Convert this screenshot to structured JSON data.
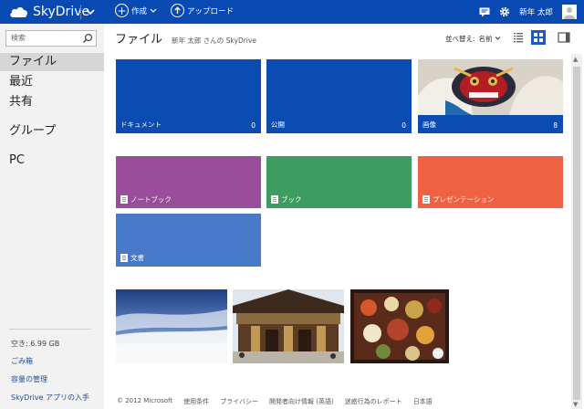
{
  "header": {
    "brand": "SkyDrive",
    "create_label": "作成",
    "upload_label": "アップロード",
    "user_name": "新年 太郎"
  },
  "sidebar": {
    "search_placeholder": "検索",
    "items": [
      {
        "label": "ファイル",
        "active": true
      },
      {
        "label": "最近"
      },
      {
        "label": "共有"
      },
      {
        "label": "グループ"
      },
      {
        "label": "PC"
      }
    ],
    "storage": "空き: 6.99 GB",
    "links": [
      "ごみ箱",
      "容量の管理",
      "SkyDrive アプリの入手"
    ]
  },
  "main": {
    "title": "ファイル",
    "owner": "新年 太郎 さんの SkyDrive",
    "sort_label": "並べ替え:",
    "sort_value": "名前",
    "folders": [
      {
        "label": "ドキュメント",
        "count": "0",
        "color": "#0a4cb2"
      },
      {
        "label": "公開",
        "count": "0",
        "color": "#0a4cb2"
      },
      {
        "label": "画像",
        "count": "8",
        "color": "#0a4cb2"
      }
    ],
    "docs": [
      {
        "label": "ノートブック",
        "color": "#9a4d9a"
      },
      {
        "label": "ブック",
        "color": "#3d9c5f"
      },
      {
        "label": "プレゼンテーション",
        "color": "#ee6243"
      },
      {
        "label": "文書",
        "color": "#4779c8"
      }
    ]
  },
  "footer": {
    "links": [
      "© 2012 Microsoft",
      "使用条件",
      "プライバシー",
      "開発者向け情報 (英語)",
      "迷惑行為のレポート",
      "日本語"
    ]
  }
}
